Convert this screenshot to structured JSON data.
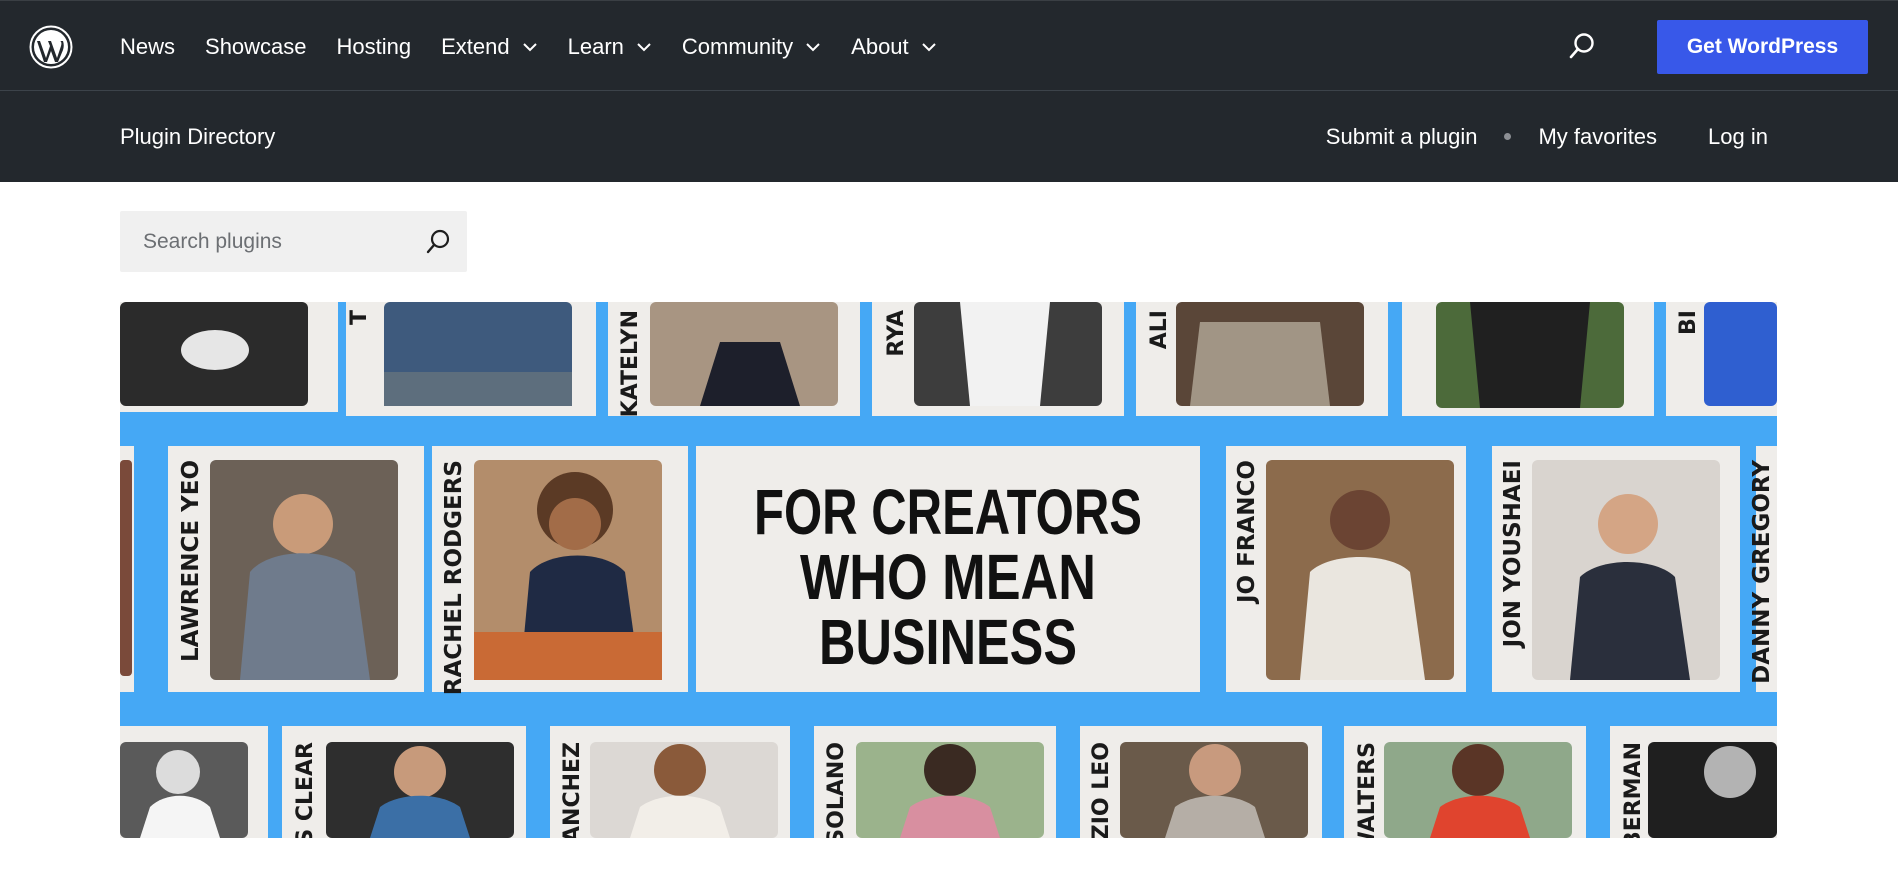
{
  "header": {
    "nav": [
      {
        "label": "News",
        "dropdown": false
      },
      {
        "label": "Showcase",
        "dropdown": false
      },
      {
        "label": "Hosting",
        "dropdown": false
      },
      {
        "label": "Extend",
        "dropdown": true
      },
      {
        "label": "Learn",
        "dropdown": true
      },
      {
        "label": "Community",
        "dropdown": true
      },
      {
        "label": "About",
        "dropdown": true
      }
    ],
    "cta_label": "Get WordPress"
  },
  "subnav": {
    "title": "Plugin Directory",
    "submit_label": "Submit a plugin",
    "favorites_label": "My favorites",
    "login_label": "Log in"
  },
  "search": {
    "placeholder": "Search plugins"
  },
  "banner": {
    "headline": [
      "FOR CREATORS",
      "WHO MEAN",
      "BUSINESS"
    ],
    "names_middle": [
      "LAWRENCE YEO",
      "RACHEL RODGERS",
      "JO FRANCO",
      "JON YOUSHAEI",
      "DANNY GREGORY"
    ],
    "names_top": [
      "T",
      "KATELYN",
      "RYA",
      "ALI",
      "BI"
    ],
    "names_bottom": [
      "ES CLEAR",
      "SANCHEZ",
      "Y SOLANO",
      "RIZIO LEO",
      "WALTERS",
      "BERMAN"
    ]
  },
  "colors": {
    "header_bg": "#23282d",
    "accent": "#3858e9",
    "banner_blue": "#45a8f5",
    "card_bg": "#efedea"
  }
}
